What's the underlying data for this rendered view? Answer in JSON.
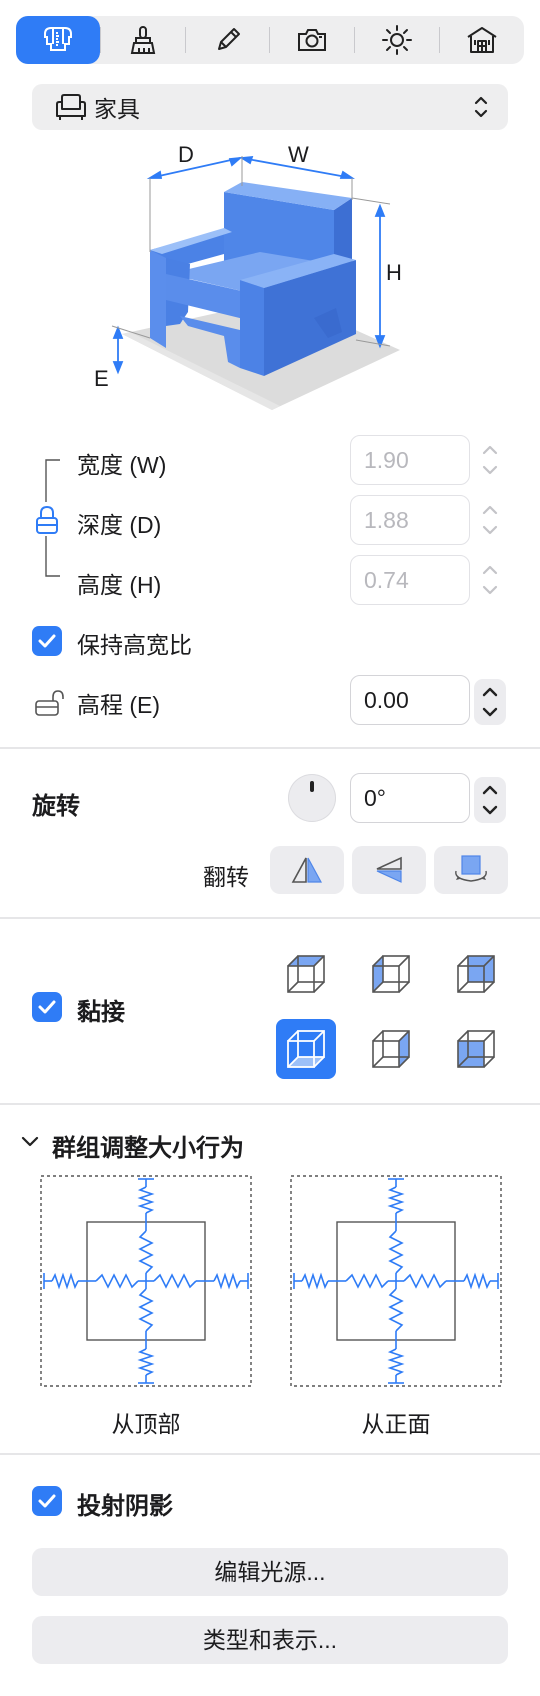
{
  "toolbar": {
    "tools": [
      {
        "icon": "caliper-icon",
        "active": true
      },
      {
        "icon": "brush-icon",
        "active": false
      },
      {
        "icon": "pencil-icon",
        "active": false
      },
      {
        "icon": "camera-icon",
        "active": false
      },
      {
        "icon": "sun-icon",
        "active": false
      },
      {
        "icon": "house-icon",
        "active": false
      }
    ]
  },
  "category": {
    "icon": "armchair-icon",
    "label": "家具"
  },
  "diagram": {
    "d": "D",
    "w": "W",
    "h": "H",
    "e": "E"
  },
  "dimensions": {
    "width": {
      "label": "宽度 (W)",
      "value": "1.90"
    },
    "depth": {
      "label": "深度 (D)",
      "value": "1.88"
    },
    "height": {
      "label": "高度 (H)",
      "value": "0.74"
    }
  },
  "keep_ratio": {
    "label": "保持高宽比",
    "checked": true
  },
  "elevation": {
    "label": "高程 (E)",
    "value": "0.00"
  },
  "rotation": {
    "title": "旋转",
    "value": "0°",
    "flip_label": "翻转"
  },
  "snap": {
    "label": "黏接",
    "checked": true,
    "selected_index": 3
  },
  "group_resize": {
    "title": "群组调整大小行为",
    "left_caption": "从顶部",
    "right_caption": "从正面"
  },
  "shadow": {
    "label": "投射阴影",
    "checked": true
  },
  "buttons": {
    "edit_light": "编辑光源...",
    "type_display": "类型和表示..."
  },
  "colors": {
    "accent": "#2f7cf6",
    "field_border": "#d4d4d8",
    "disabled_text": "#b8b8bd"
  }
}
